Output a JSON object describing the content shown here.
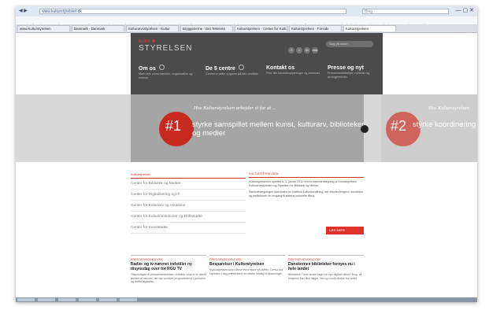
{
  "browser": {
    "url": "www.kulturstyrelsen.dk",
    "search": "Bing",
    "nav_glyph": "◀ ▶",
    "window_glyph": "— ▢ ✕",
    "favorites": [
      "Mine favoritter",
      "Yahoo",
      "Nyeste arkiver",
      "Websites - nyheder",
      "TV-Beskeder",
      "Forside - Erik Ravn",
      "Nationale Bornholm",
      "Loquatt Nature",
      "Danmarks Radio",
      "Kiosken",
      "Nyhed af Photographi",
      "Erfaringer",
      "Kulturarvsarkivets"
    ],
    "tabs": [
      {
        "label": "www.Kulturstyrelsen"
      },
      {
        "label": "Danmark - Danmark"
      },
      {
        "label": "Kulturarvsstyrelsen - Kultur"
      },
      {
        "label": "Bryggerierne - Det Tekniske"
      },
      {
        "label": "Kulturstyrelsen - Center for Kultur"
      },
      {
        "label": "Kulturstyrelsen - Forside"
      },
      {
        "label": "Kulturstyrelsen",
        "active": true
      }
    ]
  },
  "site": {
    "logo_small": "kultur ✚",
    "logo": "STYRELSEN",
    "social": [
      "f",
      "t",
      "in",
      "rss"
    ],
    "search_placeholder": "Søg på siden",
    "nav": [
      {
        "title": "Om os",
        "sub": "Mød hele vores styrelse, organisation og ledelse"
      },
      {
        "title": "De 5 centre",
        "sub": "Centrene løfter opgaver på alle områder"
      },
      {
        "title": "Kontakt os",
        "sub": "Find alle kontaktoplysninger og adresser"
      },
      {
        "title": "Presse og nyt",
        "sub": "Pressemeddelelser, nyheder og arrangementer"
      }
    ],
    "hero": {
      "heading": "Hos Kulturstyrelsen arbejder vi for at ...",
      "number": "#1",
      "text": "styrke samspillet mellem kunst, kulturarv, biblioteker og medier",
      "next_heading": "Hos Kulturstyrelsen",
      "next_number": "#2",
      "next_text": "styrke koordinering af kommunale indsatser"
    },
    "menu": [
      "Kulturstyrelsen",
      "Center for Bibliotek og Medier",
      "Center for Digitalisering og IT",
      "Center for Kulturarv og Arkitektur",
      "Center for Kulturinstitutioner og Driftsstøtte",
      "Center for Kunststøtte"
    ],
    "info": {
      "title": "KULTURSTYRELSEN",
      "p1": "Kulturstyrelsen er oprettet d. 1. januar 2012 ved en sammenlægning af Kunststyrelsen, Kulturarvsstyrelsen og Styrelsen for Bibliotek og Medier.",
      "p2": "Sammenlægningen skal skabe en kraftfuld kulturforvaltning, der tilbyder borgere, kunstnere og institutioner én indgang til statens kulturelle tilbud.",
      "button": "LÆS MERE"
    },
    "news": [
      {
        "kicker": "PRESSEMEDDELELSE",
        "title": "Radio- og tv-nævnet indstiller ny tilsynsdag over for RGU TV",
        "body": "Tilsynsdagen til pressemeddelelsen vedrører lokal-tv er blevet ændret af nævnet, der har vurderet programmerne i perioden og truffet afgørelse."
      },
      {
        "kicker": "PRESSEMEDDELELSE",
        "title": "Besparelser i Kulturstyrelsen",
        "body": "Kulturstyrelsen skal i årene frem spare på driften. Derfor har styrelsen i dag præsenteret en række forslag til tilpasninger."
      },
      {
        "kicker": "PRESSEMEDDELELSE",
        "title": "Danskernes biblioteker fornyes nu i hele landet",
        "body": "Biblioteker i hele landet tager nu nye digitale tilbud i brug, så borgerne kan låne bøger, film og musik direkte fra nettet."
      }
    ]
  }
}
